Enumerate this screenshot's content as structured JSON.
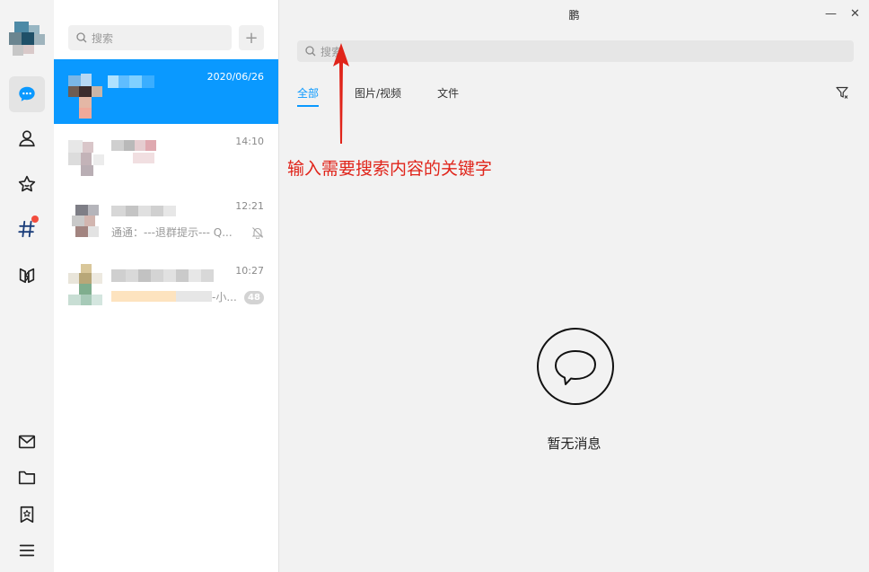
{
  "rail": {
    "icons": [
      "chat-icon",
      "contacts-icon",
      "star-icon",
      "channel-icon",
      "moments-icon",
      "mail-icon",
      "folder-icon",
      "bookmark-icon",
      "menu-icon"
    ]
  },
  "list": {
    "search_placeholder": "搜索",
    "add_label": "+",
    "conversations": [
      {
        "time": "2020/06/26",
        "preview": "",
        "badge": ""
      },
      {
        "time": "14:10",
        "preview": "",
        "badge": ""
      },
      {
        "time": "12:21",
        "preview": "通通：---退群提示--- Q...",
        "badge": ""
      },
      {
        "time": "10:27",
        "preview": "-小...",
        "badge": "48"
      }
    ]
  },
  "main": {
    "title": "鹏",
    "minimize": "—",
    "close": "✕",
    "search_placeholder": "搜索",
    "tabs": [
      "全部",
      "图片/视频",
      "文件"
    ],
    "annotation": "输入需要搜索内容的关键字",
    "empty_text": "暂无消息"
  },
  "colors": {
    "accent": "#0a99ff",
    "annotation": "#e0241a",
    "badge": "#d3d3d3"
  }
}
